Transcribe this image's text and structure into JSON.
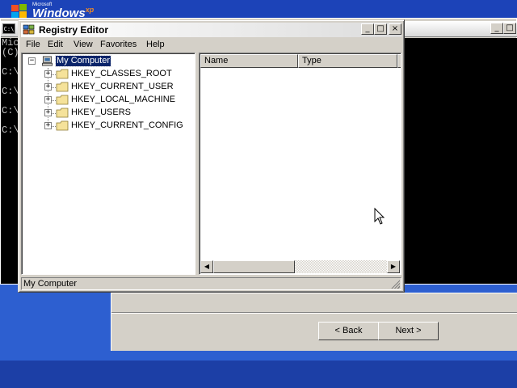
{
  "desktop": {
    "logo": {
      "microsoft": "Microsoft",
      "windows": "Windows",
      "xp": "xp"
    }
  },
  "console": {
    "icon_text": "C:\\",
    "lines": [
      "Mic",
      "(C)",
      "C:\\",
      "C:\\",
      "C:\\",
      "C:\\"
    ]
  },
  "regedit": {
    "title": "Registry Editor",
    "menu": [
      "File",
      "Edit",
      "View",
      "Favorites",
      "Help"
    ],
    "tree": {
      "root": "My Computer",
      "hives": [
        "HKEY_CLASSES_ROOT",
        "HKEY_CURRENT_USER",
        "HKEY_LOCAL_MACHINE",
        "HKEY_USERS",
        "HKEY_CURRENT_CONFIG"
      ]
    },
    "columns": [
      "Name",
      "Type",
      "D"
    ],
    "status": "My Computer"
  },
  "wizard": {
    "back_label": "< Back",
    "next_label": "Next >"
  },
  "colors": {
    "desktop": "#3a6ea5",
    "selection": "#0a246a",
    "window_face": "#d4d0c8",
    "console_bg": "#000000"
  },
  "icons": [
    "windows-flag-icon",
    "console-icon",
    "registry-icon",
    "computer-icon",
    "folder-icon",
    "minimize-icon",
    "maximize-icon",
    "close-icon",
    "arrow-left-icon",
    "arrow-right-icon",
    "cursor-icon",
    "resize-grip-icon"
  ]
}
